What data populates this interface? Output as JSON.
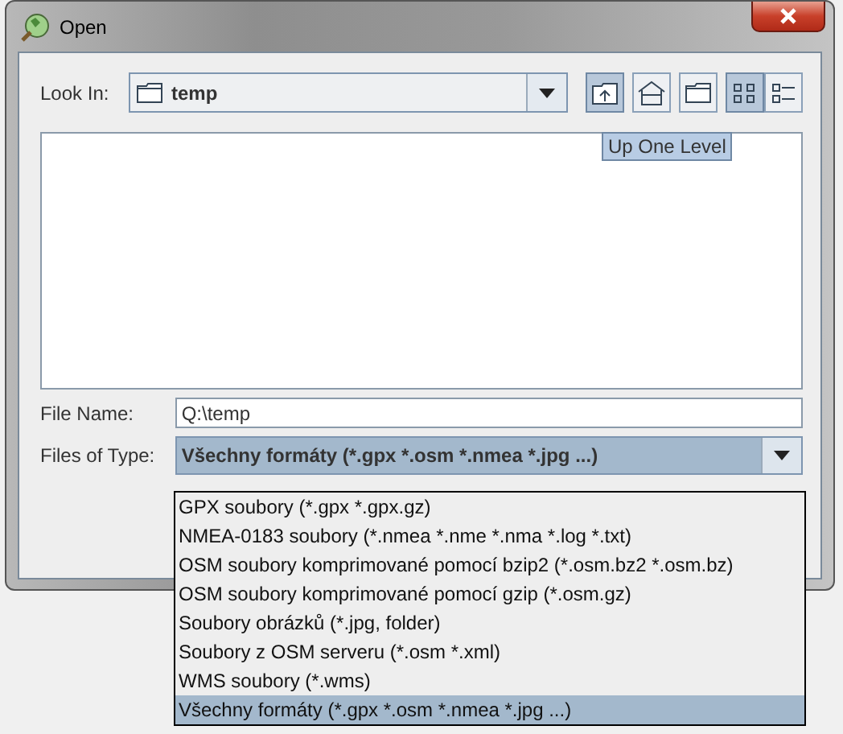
{
  "window": {
    "title": "Open"
  },
  "look_in": {
    "label": "Look In:",
    "value": "temp"
  },
  "toolbar": [
    {
      "kind": "up",
      "selected": true
    },
    {
      "kind": "home",
      "selected": false
    },
    {
      "kind": "new-folder",
      "selected": false
    },
    {
      "kind": "list",
      "selected": true
    },
    {
      "kind": "details",
      "selected": false
    }
  ],
  "tooltip": "Up One Level",
  "file_name": {
    "label": "File Name:",
    "value": "Q:\\temp"
  },
  "files_of_type": {
    "label": "Files of Type:",
    "value": "Všechny formáty (*.gpx *.osm *.nmea *.jpg ...)",
    "options": [
      {
        "label": "GPX soubory (*.gpx *.gpx.gz)",
        "selected": false
      },
      {
        "label": "NMEA-0183 soubory (*.nmea *.nme *.nma *.log *.txt)",
        "selected": false
      },
      {
        "label": "OSM soubory komprimované pomocí bzip2 (*.osm.bz2 *.osm.bz)",
        "selected": false
      },
      {
        "label": "OSM soubory komprimované pomocí gzip (*.osm.gz)",
        "selected": false
      },
      {
        "label": "Soubory obrázků (*.jpg, folder)",
        "selected": false
      },
      {
        "label": "Soubory z OSM serveru (*.osm *.xml)",
        "selected": false
      },
      {
        "label": "WMS soubory (*.wms)",
        "selected": false
      },
      {
        "label": "Všechny formáty (*.gpx *.osm *.nmea *.jpg ...)",
        "selected": true
      }
    ]
  }
}
